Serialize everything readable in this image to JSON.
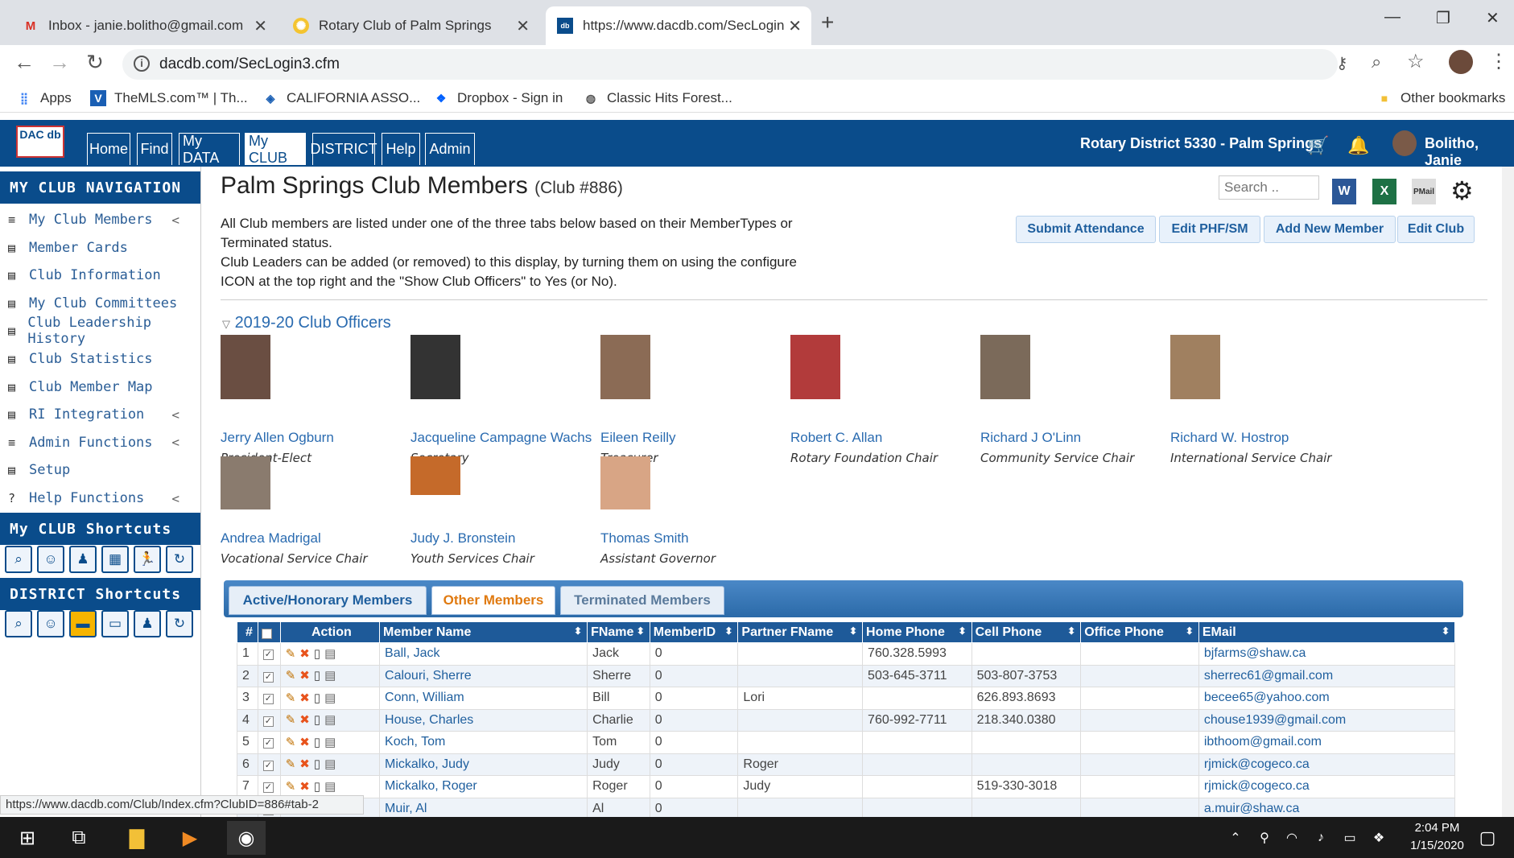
{
  "browser": {
    "tabs": [
      {
        "title": "Inbox - janie.bolitho@gmail.com",
        "favicon": "M"
      },
      {
        "title": "Rotary Club of Palm Springs",
        "favicon": "rotary"
      },
      {
        "title": "https://www.dacdb.com/SecLogin",
        "favicon": "dacdb"
      }
    ],
    "url": "dacdb.com/SecLogin3.cfm",
    "bookmarks": [
      "Apps",
      "TheMLS.com™ | Th...",
      "CALIFORNIA ASSO...",
      "Dropbox - Sign in",
      "Classic Hits Forest...",
      "Other bookmarks"
    ],
    "status_url": "https://www.dacdb.com/Club/Index.cfm?ClubID=886#tab-2"
  },
  "app": {
    "logo": "DAC db",
    "menu": [
      "Home",
      "Find",
      "My DATA",
      "My CLUB",
      "DISTRICT",
      "Help",
      "Admin"
    ],
    "active_menu": "My CLUB",
    "district": "Rotary District 5330 - Palm Springs",
    "user": "Bolitho, Janie"
  },
  "sidebar": {
    "nav_title": "MY CLUB NAVIGATION",
    "items": [
      {
        "label": "My Club Members",
        "chevron": "<"
      },
      {
        "label": "Member Cards",
        "chevron": ""
      },
      {
        "label": "Club Information",
        "chevron": ""
      },
      {
        "label": "My Club Committees",
        "chevron": ""
      },
      {
        "label": "Club Leadership History",
        "chevron": ""
      },
      {
        "label": "Club Statistics",
        "chevron": ""
      },
      {
        "label": "Club Member Map",
        "chevron": ""
      },
      {
        "label": "RI Integration",
        "chevron": "<"
      },
      {
        "label": "Admin Functions",
        "chevron": "<"
      },
      {
        "label": "Setup",
        "chevron": ""
      },
      {
        "label": "Help Functions",
        "chevron": "<"
      }
    ],
    "club_shortcuts_title": "My CLUB Shortcuts",
    "district_shortcuts_title": "DISTRICT Shortcuts"
  },
  "main": {
    "title": "Palm Springs Club Members",
    "club_no": "(Club #886)",
    "desc1": "All Club members are listed under one of the three tabs below based on their MemberTypes or Terminated status.",
    "desc2": "Club Leaders can be added (or removed) to this display, by turning them on using the configure ICON at the top right and the \"Show Club Officers\" to Yes (or No).",
    "search_placeholder": "Search ..",
    "export_labels": [
      "W",
      "X",
      "PMail"
    ],
    "actions": [
      "Submit Attendance",
      "Edit PHF/SM",
      "Add New Member",
      "Edit Club"
    ],
    "officers_title": "2019-20 Club Officers",
    "officers": [
      {
        "name": "Jerry Allen Ogburn",
        "role": "President-Elect"
      },
      {
        "name": "Jacqueline Campagne Wachs",
        "role": "Secretary"
      },
      {
        "name": "Eileen Reilly",
        "role": "Treasurer"
      },
      {
        "name": "Robert C. Allan",
        "role": "Rotary Foundation Chair"
      },
      {
        "name": "Richard J O'Linn",
        "role": "Community Service Chair"
      },
      {
        "name": "Richard W. Hostrop",
        "role": "International Service Chair"
      },
      {
        "name": "Andrea Madrigal",
        "role": "Vocational Service Chair"
      },
      {
        "name": "Judy J. Bronstein",
        "role": "Youth Services Chair"
      },
      {
        "name": "Thomas Smith",
        "role": "Assistant Governor"
      }
    ],
    "member_tabs": [
      "Active/Honorary Members",
      "Other Members",
      "Terminated Members"
    ],
    "selected_tab": "Other Members",
    "table": {
      "headers": [
        "#",
        "",
        "Action",
        "Member Name",
        "FName",
        "MemberID",
        "Partner FName",
        "Home Phone",
        "Cell Phone",
        "Office Phone",
        "EMail"
      ],
      "rows": [
        [
          "1",
          "Ball, Jack",
          "Jack",
          "0",
          "",
          "760.328.5993",
          "",
          "",
          "bjfarms@shaw.ca"
        ],
        [
          "2",
          "Calouri, Sherre",
          "Sherre",
          "0",
          "",
          "503-645-3711",
          "503-807-3753",
          "",
          "sherrec61@gmail.com"
        ],
        [
          "3",
          "Conn, William",
          "Bill",
          "0",
          "Lori",
          "",
          "626.893.8693",
          "",
          "becee65@yahoo.com"
        ],
        [
          "4",
          "House, Charles",
          "Charlie",
          "0",
          "",
          "760-992-7711",
          "218.340.0380",
          "",
          "chouse1939@gmail.com"
        ],
        [
          "5",
          "Koch, Tom",
          "Tom",
          "0",
          "",
          "",
          "",
          "",
          "ibthoom@gmail.com"
        ],
        [
          "6",
          "Mickalko, Judy",
          "Judy",
          "0",
          "Roger",
          "",
          "",
          "",
          "rjmick@cogeco.ca"
        ],
        [
          "7",
          "Mickalko, Roger",
          "Roger",
          "0",
          "Judy",
          "",
          "519-330-3018",
          "",
          "rjmick@cogeco.ca"
        ],
        [
          "8",
          "Muir, Al",
          "Al",
          "0",
          "",
          "",
          "",
          "",
          "a.muir@shaw.ca"
        ]
      ]
    }
  },
  "taskbar": {
    "time": "2:04 PM",
    "date": "1/15/2020"
  },
  "colors": {
    "brand": "#0a4c8b",
    "accent": "#e07a10",
    "link": "#2a6bb0"
  }
}
